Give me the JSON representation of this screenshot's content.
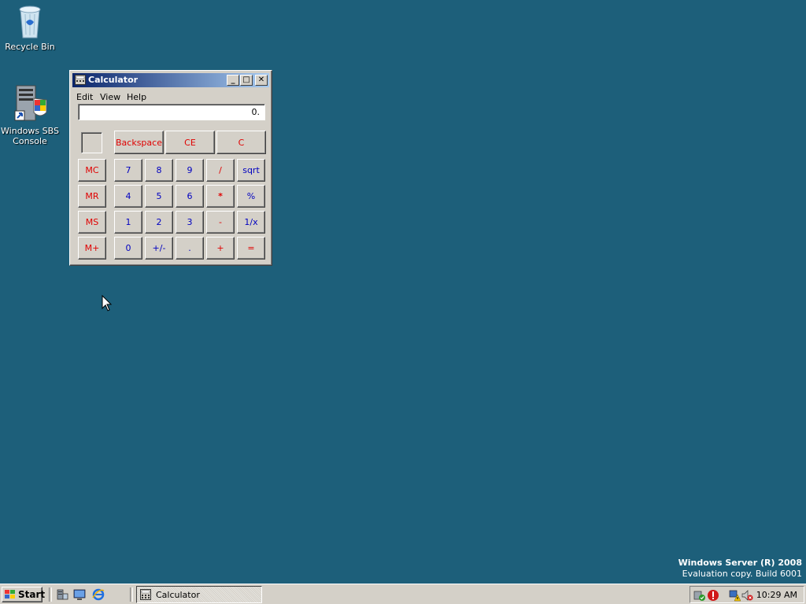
{
  "desktop": {
    "icons": [
      {
        "label": "Recycle Bin",
        "icon": "recycle-bin-icon"
      },
      {
        "label": "Windows SBS Console",
        "icon": "server-console-icon"
      }
    ],
    "watermark": {
      "line1": "Windows Server (R) 2008",
      "line2": "Evaluation copy. Build 6001"
    }
  },
  "calculator": {
    "title": "Calculator",
    "menu": [
      "Edit",
      "View",
      "Help"
    ],
    "display": "0.",
    "buttons": {
      "backspace": "Backspace",
      "ce": "CE",
      "c": "C",
      "mc": "MC",
      "mr": "MR",
      "ms": "MS",
      "mplus": "M+",
      "n7": "7",
      "n8": "8",
      "n9": "9",
      "div": "/",
      "sqrt": "sqrt",
      "n4": "4",
      "n5": "5",
      "n6": "6",
      "mul": "*",
      "pct": "%",
      "n1": "1",
      "n2": "2",
      "n3": "3",
      "sub": "-",
      "inv": "1/x",
      "n0": "0",
      "sign": "+/-",
      "dot": ".",
      "add": "+",
      "eq": "="
    },
    "window_buttons": {
      "minimize": "_",
      "maximize": "□",
      "close": "✕"
    }
  },
  "taskbar": {
    "start_label": "Start",
    "task_label": "Calculator",
    "clock": "10:29 AM"
  },
  "colors": {
    "desktop": "#1d5f7a",
    "title_start": "#0a246a",
    "title_end": "#a6caf0",
    "digit": "#0000c0",
    "operator": "#e00000"
  }
}
